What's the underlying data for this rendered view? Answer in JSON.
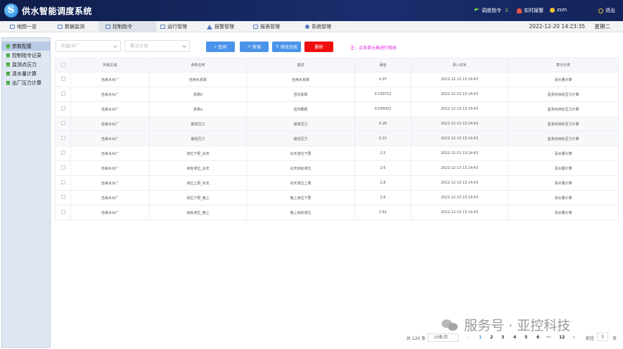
{
  "app": {
    "title": "供水智能调度系统"
  },
  "header": {
    "dispatch_label": "调度指令",
    "dispatch_count": "3",
    "alarm_label": "实时报警",
    "user_name": "zsm",
    "logout_label": "退出"
  },
  "nav": {
    "items": [
      {
        "label": "地图一览",
        "icon": "map-icon"
      },
      {
        "label": "数据监测",
        "icon": "monitor-icon"
      },
      {
        "label": "控制指令",
        "icon": "control-icon"
      },
      {
        "label": "运行管理",
        "icon": "operation-icon"
      },
      {
        "label": "报警管理",
        "icon": "alarm-icon"
      },
      {
        "label": "报表管理",
        "icon": "report-icon"
      },
      {
        "label": "系统管理",
        "icon": "system-icon"
      }
    ],
    "active_index": 2,
    "datetime": "2022-12-20 14:23:35",
    "weekday": "星期二"
  },
  "sidebar": {
    "items": [
      {
        "label": "参数配置"
      },
      {
        "label": "控制指令记录"
      },
      {
        "label": "监测点压力"
      },
      {
        "label": "清水量计算"
      },
      {
        "label": "出厂压力计算"
      }
    ],
    "active_index": 0
  },
  "filters": {
    "plant_placeholder": "所属水厂",
    "category_placeholder": "算法分类"
  },
  "toolbar": {
    "query": "查询",
    "add": "新增",
    "edit": "修改完成",
    "delete": "删除",
    "hint": "注：点击单元格进行修改"
  },
  "table": {
    "headers": [
      "所属区域",
      "参数名称",
      "描述",
      "阈值",
      "录入时间",
      "算法分类"
    ],
    "rows": [
      [
        "自来水水厂",
        "自用水系数",
        "自用水系数",
        "0.97",
        "2022-12-13 13:14:43",
        "清水量计算"
      ],
      [
        "自来水水厂",
        "系数b",
        "回归系数",
        "0.239752",
        "2022-12-13 13:14:43",
        "监测点目标压力计算"
      ],
      [
        "自来水水厂",
        "系数a",
        "回归截距",
        "0.036002",
        "2022-12-13 13:14:43",
        "监测点目标压力计算"
      ],
      [
        "自来水水厂",
        "最高压力",
        "最高压力",
        "0.26",
        "2022-12-13 13:14:43",
        "监测点目标压力计算"
      ],
      [
        "自来水水厂",
        "最低压力",
        "最低压力",
        "0.22",
        "2022-12-13 13:14:43",
        "监测点目标压力计算"
      ],
      [
        "自来水水厂",
        "液位下限_白天",
        "白天液位下限",
        "2.5",
        "2022-12-13 13:14:43",
        "清水量计算"
      ],
      [
        "自来水水厂",
        "目标液位_白天",
        "白天目标液位",
        "2.6",
        "2022-12-13 13:14:43",
        "清水量计算"
      ],
      [
        "自来水水厂",
        "液位上限_白天",
        "白天液位上限",
        "2.8",
        "2022-12-13 13:14:43",
        "清水量计算"
      ],
      [
        "自来水水厂",
        "液位下限_晚上",
        "晚上液位下限",
        "2.6",
        "2022-12-13 13:14:43",
        "清水量计算"
      ],
      [
        "自来水水厂",
        "目标液位_晚上",
        "晚上目标液位",
        "2.61",
        "2022-12-13 13:14:43",
        "清水量计算"
      ]
    ]
  },
  "pagination": {
    "total": "共 120 条",
    "page_size": "10条/页",
    "pages": [
      "1",
      "2",
      "3",
      "4",
      "5",
      "6",
      "···",
      "12"
    ],
    "goto_label": "前往",
    "goto_value": "1",
    "page_unit": "页"
  },
  "watermark": {
    "text": "服务号 · 亚控科技"
  }
}
